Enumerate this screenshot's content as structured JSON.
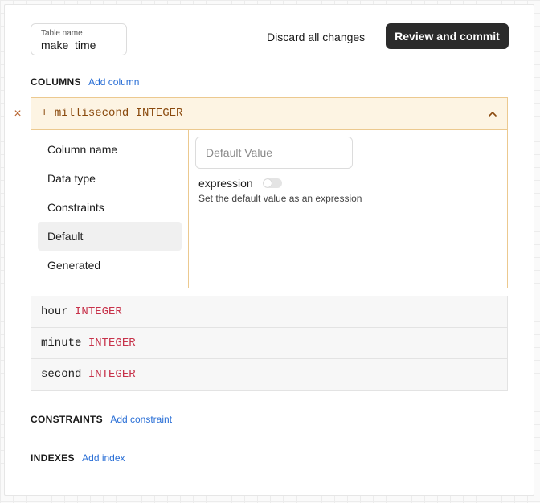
{
  "table_name": {
    "label": "Table name",
    "value": "make_time"
  },
  "toolbar": {
    "discard_label": "Discard all changes",
    "review_label": "Review and commit"
  },
  "columns_section": {
    "title": "COLUMNS",
    "add_label": "Add column"
  },
  "expanded_column": {
    "prefix": "+",
    "name": "millisecond",
    "type": "INTEGER",
    "remove_glyph": "×",
    "menu": [
      "Column name",
      "Data type",
      "Constraints",
      "Default",
      "Generated"
    ],
    "active_menu": "Default",
    "default_placeholder": "Default Value",
    "expression_label": "expression",
    "expression_enabled": false,
    "expression_help": "Set the default value as an expression"
  },
  "columns": [
    {
      "name": "hour",
      "type": "INTEGER"
    },
    {
      "name": "minute",
      "type": "INTEGER"
    },
    {
      "name": "second",
      "type": "INTEGER"
    }
  ],
  "constraints_section": {
    "title": "CONSTRAINTS",
    "add_label": "Add constraint"
  },
  "indexes_section": {
    "title": "INDEXES",
    "add_label": "Add index"
  },
  "icons": {
    "remove": "close-icon",
    "collapse": "chevron-up-icon"
  },
  "colors": {
    "accent_link": "#2a6fd6",
    "type_red": "#c7324a",
    "expanded_border": "#ecc98f",
    "expanded_header_bg": "#fdf4e3",
    "primary_button": "#2b2b2b"
  }
}
